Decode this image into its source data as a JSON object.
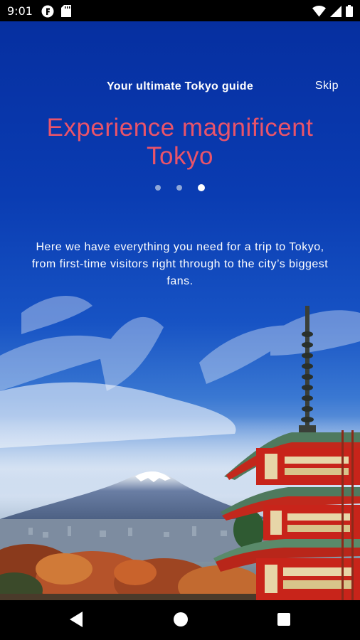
{
  "status_bar": {
    "time": "9:01",
    "left_icons": [
      "f-app-icon",
      "sd-card-icon"
    ],
    "right_icons": [
      "wifi-icon",
      "signal-icon",
      "battery-icon"
    ]
  },
  "header": {
    "title": "Your ultimate Tokyo guide",
    "skip_label": "Skip"
  },
  "onboarding": {
    "headline": "Experience magnificent Tokyo",
    "page_index": 3,
    "page_count": 3,
    "description": "Here we have everything you need for a trip to Tokyo, from first-time visitors right through to the city’s biggest fans."
  },
  "colors": {
    "headline": "#e9546a",
    "sky_top": "#062fa0",
    "dot_inactive": "#8ea6d8",
    "dot_active": "#ffffff"
  },
  "nav_bar": {
    "icons": [
      "back-icon",
      "home-icon",
      "recents-icon"
    ]
  }
}
